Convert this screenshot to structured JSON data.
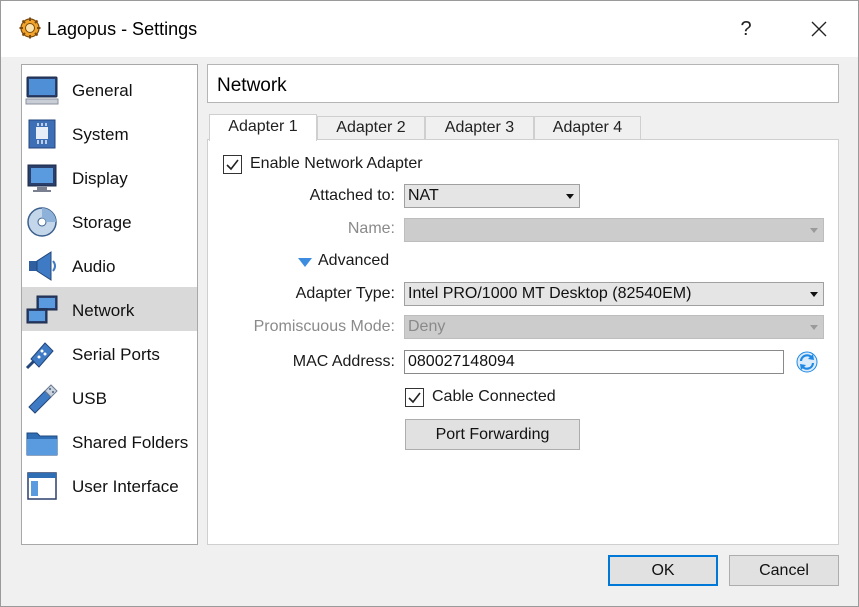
{
  "window": {
    "title": "Lagopus - Settings",
    "help_label": "?"
  },
  "sidebar": {
    "items": [
      {
        "label": "General",
        "icon": "general-icon",
        "selected": false
      },
      {
        "label": "System",
        "icon": "system-icon",
        "selected": false
      },
      {
        "label": "Display",
        "icon": "display-icon",
        "selected": false
      },
      {
        "label": "Storage",
        "icon": "storage-icon",
        "selected": false
      },
      {
        "label": "Audio",
        "icon": "audio-icon",
        "selected": false
      },
      {
        "label": "Network",
        "icon": "network-icon",
        "selected": true
      },
      {
        "label": "Serial Ports",
        "icon": "serial-ports-icon",
        "selected": false
      },
      {
        "label": "USB",
        "icon": "usb-icon",
        "selected": false
      },
      {
        "label": "Shared Folders",
        "icon": "shared-folders-icon",
        "selected": false
      },
      {
        "label": "User Interface",
        "icon": "user-interface-icon",
        "selected": false
      }
    ]
  },
  "section": {
    "title": "Network"
  },
  "tabs": [
    {
      "label": "Adapter 1",
      "active": true
    },
    {
      "label": "Adapter 2",
      "active": false
    },
    {
      "label": "Adapter 3",
      "active": false
    },
    {
      "label": "Adapter 4",
      "active": false
    }
  ],
  "adapter": {
    "enable_label": "Enable Network Adapter",
    "enable_checked": true,
    "attached_to_label": "Attached to:",
    "attached_to_value": "NAT",
    "name_label": "Name:",
    "name_value": "",
    "advanced_label": "Advanced",
    "adapter_type_label": "Adapter Type:",
    "adapter_type_value": "Intel PRO/1000 MT Desktop (82540EM)",
    "promiscuous_label": "Promiscuous Mode:",
    "promiscuous_value": "Deny",
    "mac_label": "MAC Address:",
    "mac_value": "080027148094",
    "cable_label": "Cable Connected",
    "cable_checked": true,
    "port_forwarding_label": "Port Forwarding"
  },
  "footer": {
    "ok_label": "OK",
    "cancel_label": "Cancel"
  },
  "colors": {
    "accent": "#0078d7",
    "selected_bg": "#d9d9d9",
    "refresh_icon": "#1e88e5"
  }
}
